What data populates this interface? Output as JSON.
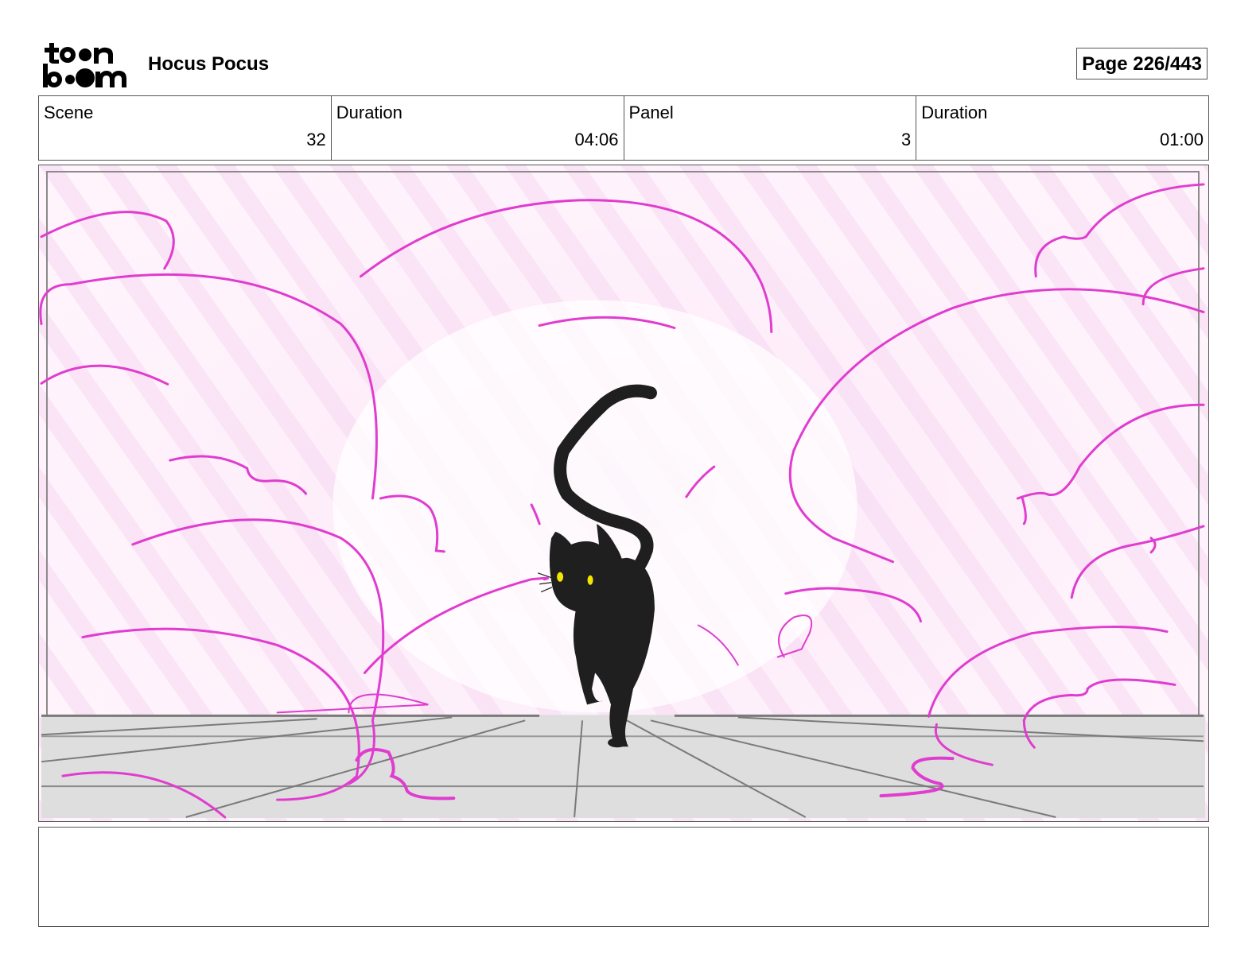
{
  "header": {
    "logo_text": "toon boom",
    "project_title": "Hocus Pocus",
    "page_label": "Page 226/443"
  },
  "info": {
    "scene_label": "Scene",
    "scene_value": "32",
    "scene_duration_label": "Duration",
    "scene_duration_value": "04:06",
    "panel_label": "Panel",
    "panel_value": "3",
    "panel_duration_label": "Duration",
    "panel_duration_value": "01:00"
  },
  "colors": {
    "smoke_stroke": "#e03ccf",
    "smoke_fill": "#f9dff5",
    "floor": "#dedede",
    "floor_lines": "#7a7a7a",
    "cat": "#1f1f1f",
    "cat_eyes": "#f2e600",
    "border": "#555555"
  },
  "notes": {
    "text": ""
  }
}
